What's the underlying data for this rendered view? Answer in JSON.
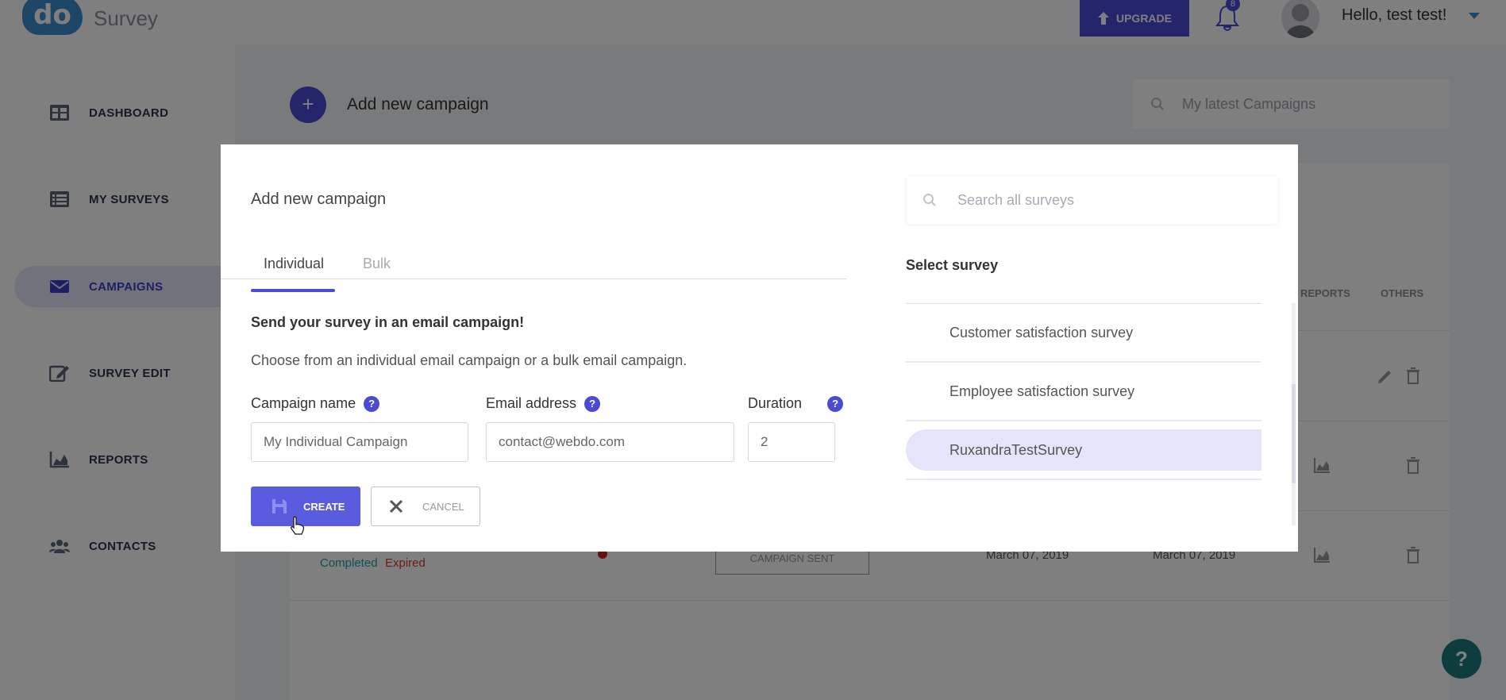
{
  "header": {
    "logo_text": "do",
    "app_title": "Survey",
    "upgrade_label": "UPGRADE",
    "notification_count": "8",
    "greeting": "Hello, test test!"
  },
  "sidebar": {
    "items": [
      {
        "label": "DASHBOARD",
        "icon": "dashboard-icon"
      },
      {
        "label": "MY SURVEYS",
        "icon": "list-icon"
      },
      {
        "label": "CAMPAIGNS",
        "icon": "envelope-icon",
        "active": true
      },
      {
        "label": "SURVEY EDIT",
        "icon": "edit-icon"
      },
      {
        "label": "REPORTS",
        "icon": "chart-icon"
      },
      {
        "label": "CONTACTS",
        "icon": "users-icon"
      }
    ]
  },
  "main": {
    "add_campaign_label": "Add new campaign",
    "search_placeholder": "My latest Campaigns",
    "table_headers": {
      "reports": "REPORTS",
      "others": "OTHERS"
    },
    "row": {
      "status_completed": "Completed",
      "status_expired": "Expired",
      "campaign_badge": "CAMPAIGN SENT",
      "date_start": "March 07, 2019",
      "date_end": "March 07, 2019"
    }
  },
  "modal": {
    "title": "Add new campaign",
    "tabs": [
      {
        "label": "Individual",
        "active": true
      },
      {
        "label": "Bulk",
        "active": false
      }
    ],
    "heading": "Send your survey in an email campaign!",
    "subtext": "Choose from an individual email campaign or a bulk email campaign.",
    "fields": {
      "campaign_name": {
        "label": "Campaign name",
        "value": "My Individual Campaign"
      },
      "email": {
        "label": "Email address",
        "value": "contact@webdo.com"
      },
      "duration": {
        "label": "Duration",
        "value": "2"
      }
    },
    "create_label": "CREATE",
    "cancel_label": "CANCEL",
    "survey_search_placeholder": "Search all surveys",
    "select_title": "Select survey",
    "surveys": [
      {
        "name": "Customer satisfaction survey",
        "selected": false
      },
      {
        "name": "Employee satisfaction survey",
        "selected": false
      },
      {
        "name": "RuxandraTestSurvey",
        "selected": true
      }
    ]
  },
  "help_fab": "?",
  "colors": {
    "accent": "#4a4ad6",
    "selected_bg": "#e4e5fa",
    "completed": "#1aa3a3",
    "expired": "#d33b3b",
    "status_dot": "#d32020"
  }
}
